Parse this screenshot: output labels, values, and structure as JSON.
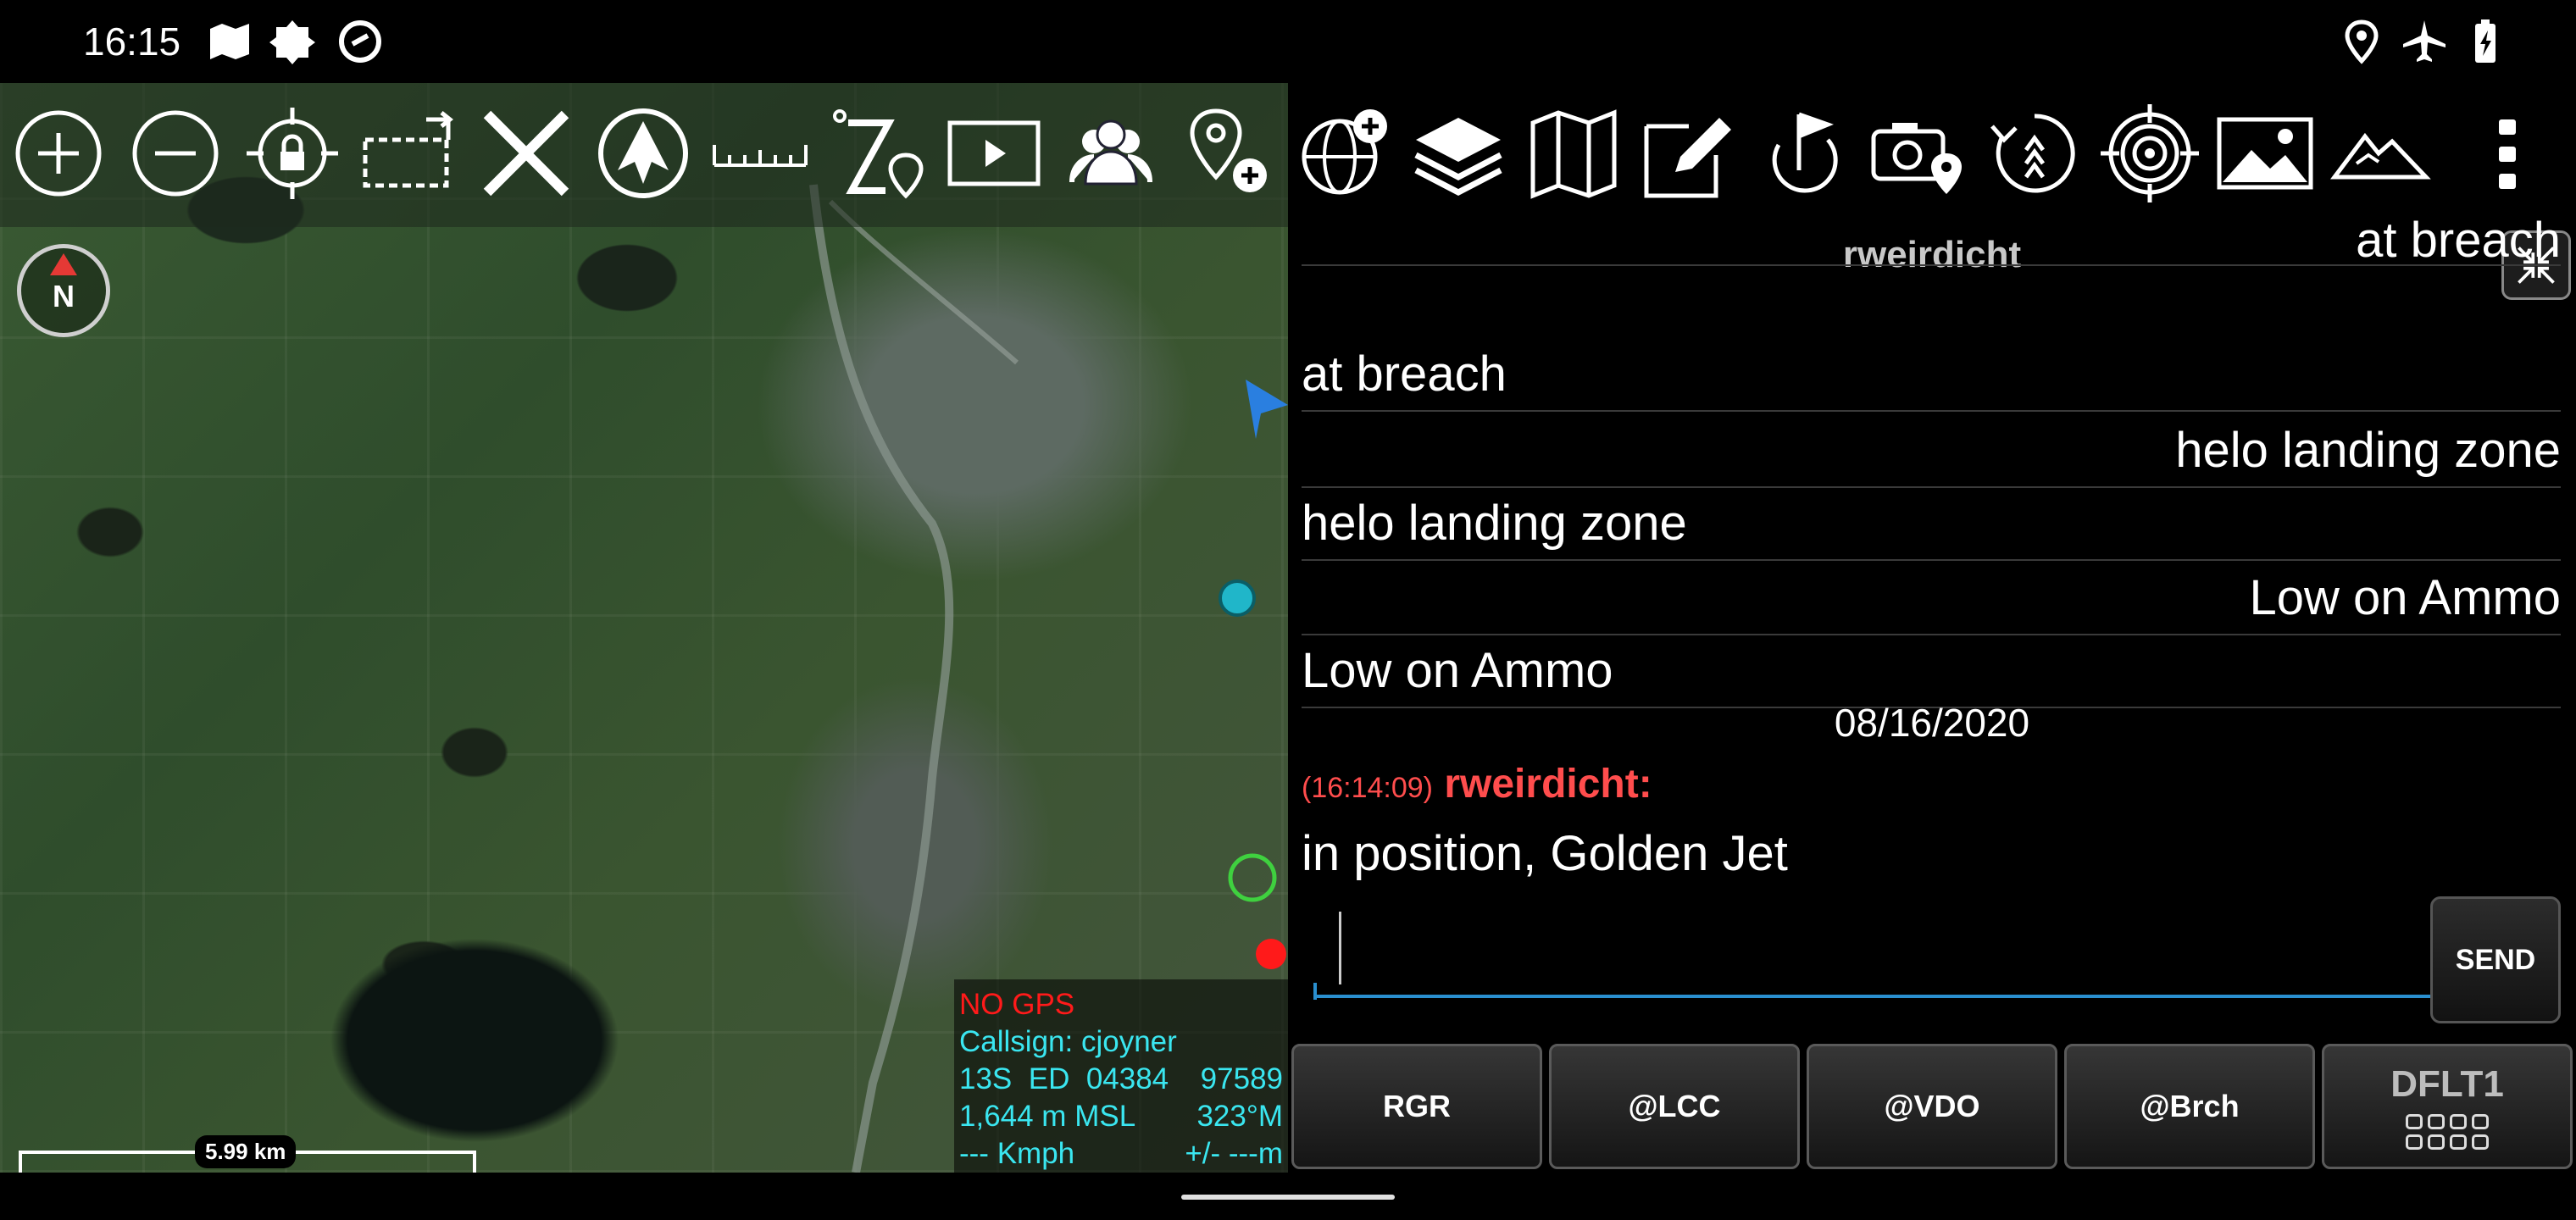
{
  "status_bar": {
    "time": "16:15",
    "left_icons": [
      "map-icon",
      "shield-icon",
      "sync-icon"
    ],
    "right_icons": [
      "location-pin-icon",
      "airplane-mode-icon",
      "battery-charging-icon"
    ]
  },
  "map_toolbar": {
    "buttons": [
      "zoom-in-icon",
      "zoom-out-icon",
      "lock-location-icon",
      "pan-icon",
      "cancel-icon",
      "plane-icon",
      "ruler-icon",
      "elevation-marker-icon",
      "video-icon",
      "contacts-icon",
      "add-point-icon"
    ]
  },
  "panel_toolbar": {
    "buttons": [
      "add-globe-icon",
      "layers-icon",
      "map-icon",
      "edit-icon",
      "route-flag-icon",
      "camera-location-icon",
      "bread-crumbs-icon",
      "target-icon",
      "image-icon",
      "terrain-icon",
      "overflow-menu-icon"
    ]
  },
  "compass": {
    "label": "N"
  },
  "map_info": {
    "gps_status": "NO GPS",
    "callsign": "Callsign: cjoyner",
    "grid_zone": "13S",
    "grid_square": "ED",
    "easting": "04384",
    "northing": "97589",
    "altitude": "1,644 m MSL",
    "heading": "323°M",
    "speed": "--- Kmph",
    "accuracy": "+/- ---m"
  },
  "scale": {
    "label": "5.99 km"
  },
  "chat": {
    "title": "rweirdicht",
    "messages": [
      {
        "text": "at breach",
        "side": "right"
      },
      {
        "text": "at breach",
        "side": "left"
      },
      {
        "text": "helo landing zone",
        "side": "right"
      },
      {
        "text": "helo landing zone",
        "side": "left"
      },
      {
        "text": "Low on Ammo",
        "side": "right"
      },
      {
        "text": "Low on Ammo",
        "side": "left"
      }
    ],
    "date": "08/16/2020",
    "last_time": "(16:14:09)",
    "last_sender": "rweirdicht:",
    "last_text": "in position, Golden Jet",
    "input_value": "",
    "send_label": "SEND"
  },
  "quick_buttons": [
    "RGR",
    "@LCC",
    "@VDO",
    "@Brch",
    "DFLT1"
  ],
  "colors": {
    "accent_blue": "#2a8fcf",
    "alert_red": "#ff1a1a",
    "info_cyan": "#3ae6f0",
    "sender_red": "#ff4d4d"
  }
}
